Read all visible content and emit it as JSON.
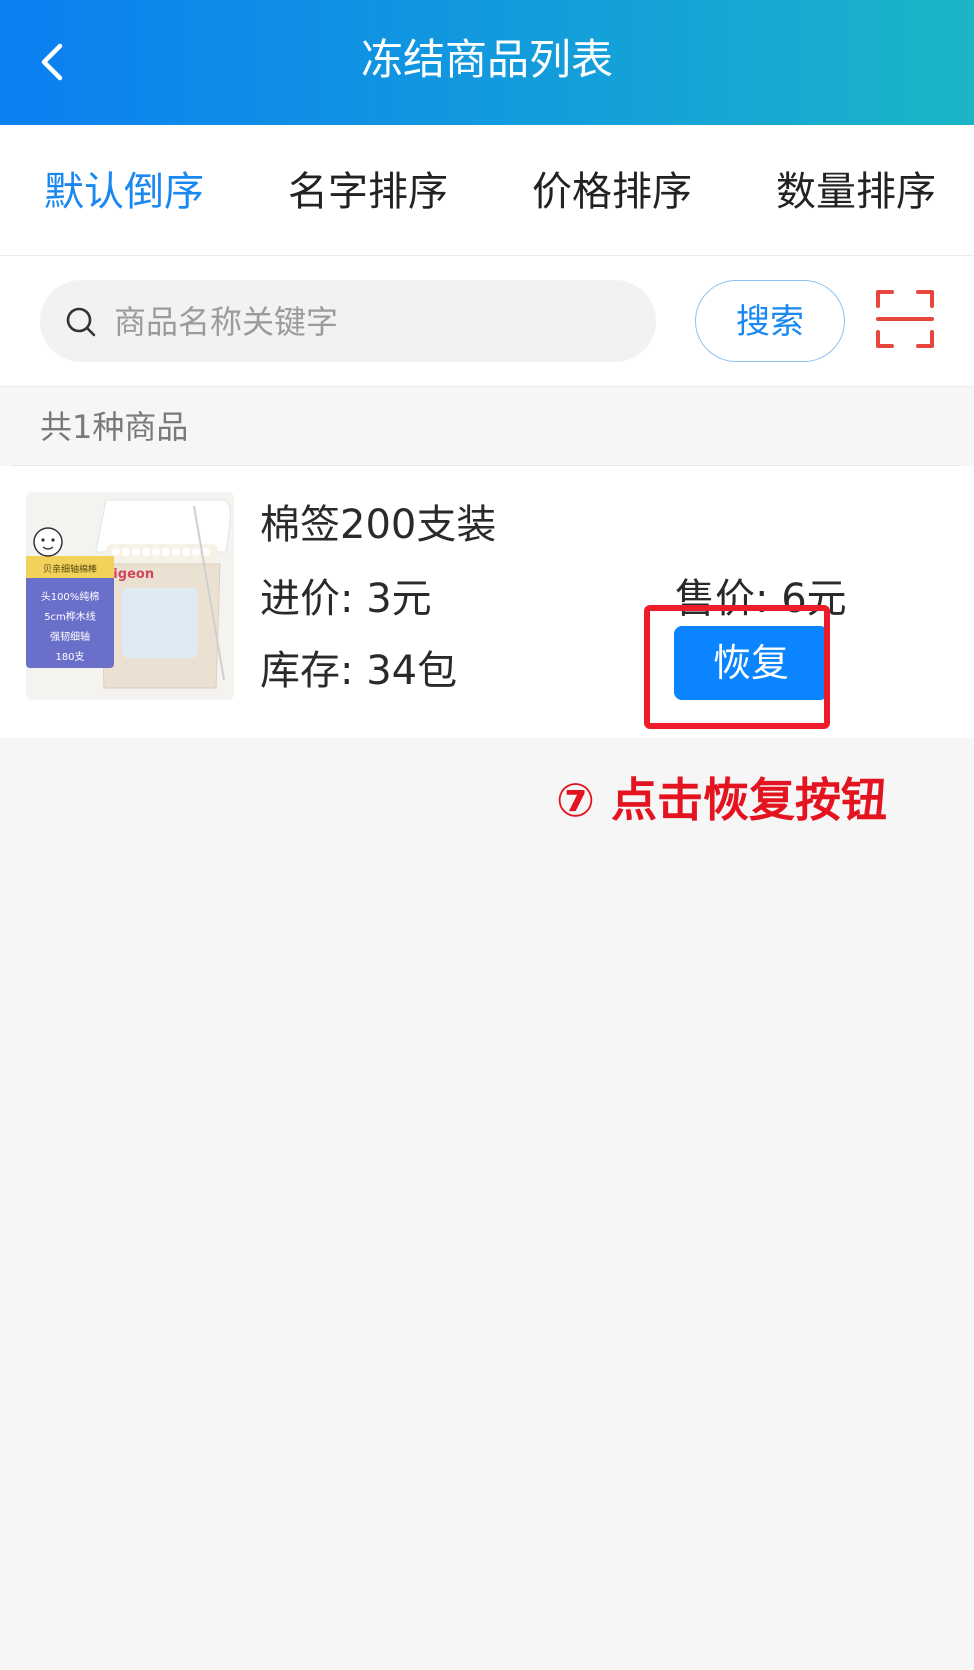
{
  "header": {
    "title": "冻结商品列表"
  },
  "sort_tabs": [
    {
      "label": "默认倒序",
      "active": true
    },
    {
      "label": "名字排序",
      "active": false
    },
    {
      "label": "价格排序",
      "active": false
    },
    {
      "label": "数量排序",
      "active": false
    }
  ],
  "search": {
    "placeholder": "商品名称关键字",
    "value": "",
    "button_label": "搜索"
  },
  "summary": {
    "count_text": "共1种商品"
  },
  "products": [
    {
      "name": "棉签200支装",
      "cost_price": "进价: 3元",
      "sale_price": "售价: 6元",
      "stock": "库存:  34包",
      "restore_label": "恢复",
      "image_texts": {
        "brand": "pigeon",
        "label_top": "贝亲细轴棉棒",
        "line1": "头100%纯棉",
        "line2": "5cm桦木线",
        "line3": "强韧细轴",
        "line4": "180支"
      }
    }
  ],
  "annotation": {
    "text": "⑦ 点击恢复按钮"
  },
  "colors": {
    "header_start": "#0a7ff2",
    "header_end": "#1bb5c6",
    "accent": "#1a88f0",
    "restore_button": "#0a84ff",
    "scan_icon": "#e8453c",
    "annotation": "#e3141f"
  }
}
